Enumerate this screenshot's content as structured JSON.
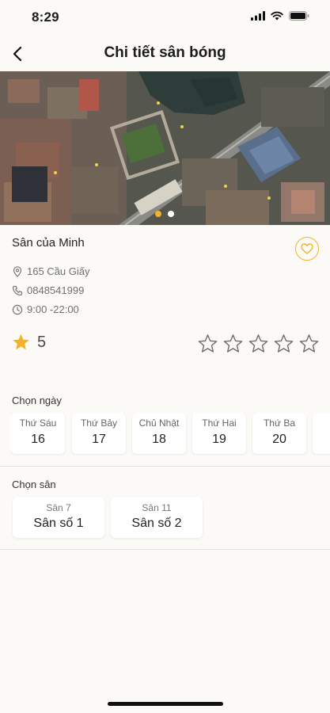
{
  "status_bar": {
    "time": "8:29"
  },
  "header": {
    "title": "Chi tiết sân bóng"
  },
  "carousel": {
    "count": 2,
    "active_index": 0,
    "active_color": "#f3b229",
    "inactive_color": "#ffffff"
  },
  "venue": {
    "name": "Sân của Minh",
    "address": "165 Cầu Giấy",
    "phone": "0848541999",
    "hours": "9:00 -22:00",
    "rating": "5",
    "user_rating_stars": 5
  },
  "dates": {
    "title": "Chọn ngày",
    "items": [
      {
        "day": "Thứ Sáu",
        "date": "16"
      },
      {
        "day": "Thứ Bảy",
        "date": "17"
      },
      {
        "day": "Chủ Nhật",
        "date": "18"
      },
      {
        "day": "Thứ Hai",
        "date": "19"
      },
      {
        "day": "Thứ Ba",
        "date": "20"
      },
      {
        "day": "T",
        "date": ""
      }
    ]
  },
  "courts": {
    "title": "Chọn sân",
    "items": [
      {
        "sub": "Sân 7",
        "name": "Sân số 1"
      },
      {
        "sub": "Sân 11",
        "name": "Sân số 2"
      }
    ]
  },
  "colors": {
    "accent": "#f3b229",
    "background": "#fbfaf7"
  }
}
